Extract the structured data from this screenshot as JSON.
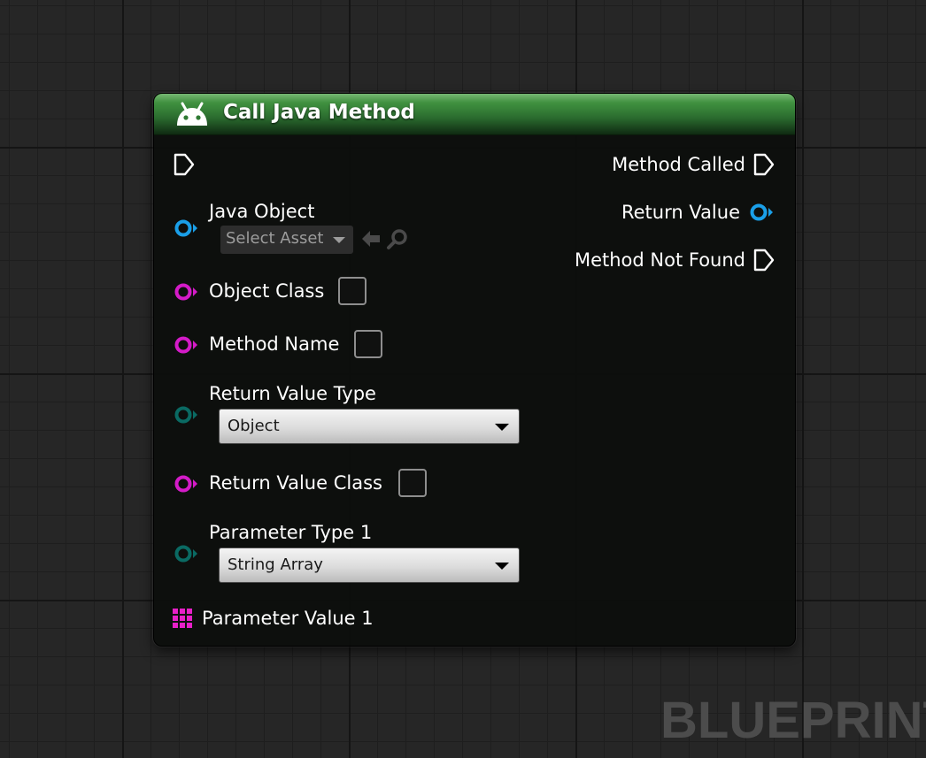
{
  "node": {
    "title": "Call Java Method",
    "header_color": "#3b8a3c",
    "icon": "android-icon",
    "inputs": {
      "java_object": {
        "label": "Java Object",
        "asset_picker_label": "Select Asset"
      },
      "object_class": {
        "label": "Object Class"
      },
      "method_name": {
        "label": "Method Name"
      },
      "return_value_type": {
        "label": "Return Value Type",
        "selected": "Object"
      },
      "return_value_class": {
        "label": "Return Value Class"
      },
      "parameter_type_1": {
        "label": "Parameter Type 1",
        "selected": "String Array"
      },
      "parameter_value_1": {
        "label": "Parameter Value 1"
      }
    },
    "outputs": {
      "method_called": {
        "label": "Method Called"
      },
      "return_value": {
        "label": "Return Value"
      },
      "method_not_found": {
        "label": "Method Not Found"
      }
    }
  },
  "pin_colors": {
    "exec": "#ffffff",
    "object": "#1a9fe8",
    "class": "#d41bc8",
    "enum": "#0a6a63",
    "array": "#e820c8"
  },
  "watermark": "BLUEPRINT"
}
